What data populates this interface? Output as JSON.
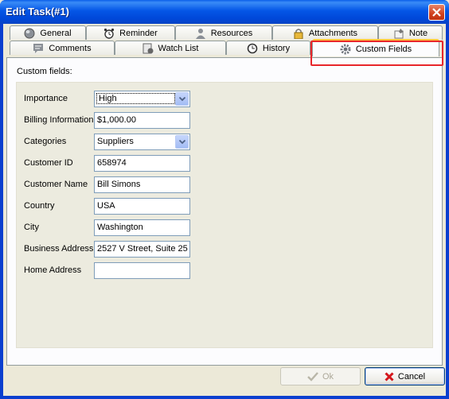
{
  "window": {
    "title": "Edit Task(#1)"
  },
  "tabs_row1": [
    {
      "label": "General",
      "icon": "globe-icon"
    },
    {
      "label": "Reminder",
      "icon": "alarm-clock-icon"
    },
    {
      "label": "Resources",
      "icon": "person-icon"
    },
    {
      "label": "Attachments",
      "icon": "lock-icon"
    },
    {
      "label": "Note",
      "icon": "pin-note-icon"
    }
  ],
  "tabs_row2": [
    {
      "label": "Comments",
      "icon": "comments-icon"
    },
    {
      "label": "Watch List",
      "icon": "watch-list-icon"
    },
    {
      "label": "History",
      "icon": "history-icon"
    },
    {
      "label": "Custom Fields",
      "icon": "gear-icon",
      "active": true
    }
  ],
  "panel": {
    "caption": "Custom fields:",
    "fields": [
      {
        "label": "Importance",
        "value": "High",
        "type": "combo"
      },
      {
        "label": "Billing Information",
        "value": "$1,000.00",
        "type": "text"
      },
      {
        "label": "Categories",
        "value": "Suppliers",
        "type": "combo"
      },
      {
        "label": "Customer ID",
        "value": "658974",
        "type": "text"
      },
      {
        "label": "Customer Name",
        "value": "Bill Simons",
        "type": "text"
      },
      {
        "label": "Country",
        "value": "USA",
        "type": "text"
      },
      {
        "label": "City",
        "value": "Washington",
        "type": "text"
      },
      {
        "label": "Business Address",
        "value": "2527 V Street, Suite 25",
        "type": "text"
      },
      {
        "label": "Home Address",
        "value": "",
        "type": "text"
      }
    ]
  },
  "buttons": {
    "ok": "Ok",
    "cancel": "Cancel"
  },
  "colors": {
    "titlebar": "#0054e3",
    "highlight": "#e8262b",
    "active_tab_accent": "#ffc83c"
  }
}
